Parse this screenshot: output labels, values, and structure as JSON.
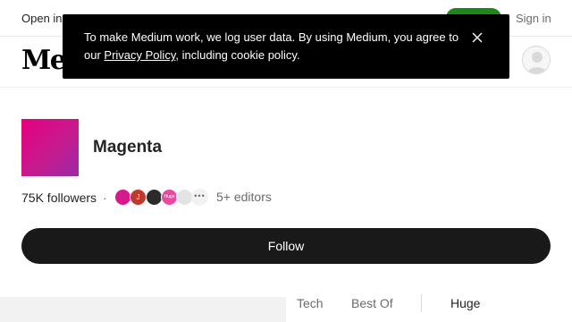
{
  "topbar": {
    "open_in_app": "Open in app",
    "sign_in": "Sign in"
  },
  "header": {
    "logo": "Medium"
  },
  "banner": {
    "text_before": "To make Medium work, we log user data. By using Medium, you agree to our ",
    "link": "Privacy Policy",
    "text_after": ", including cookie policy."
  },
  "publication": {
    "name": "Magenta",
    "followers": "75K followers",
    "separator": "·",
    "editors": "5+ editors",
    "editor_avatars": [
      "",
      "J",
      "",
      "Huge",
      ""
    ],
    "more": "•••",
    "follow_label": "Follow"
  },
  "tabs": {
    "items": [
      "Tech",
      "Best Of",
      "Huge"
    ]
  },
  "colors": {
    "follow_bg": "#191919",
    "brand_green": "#1a8917",
    "magenta": "#e6007e"
  }
}
